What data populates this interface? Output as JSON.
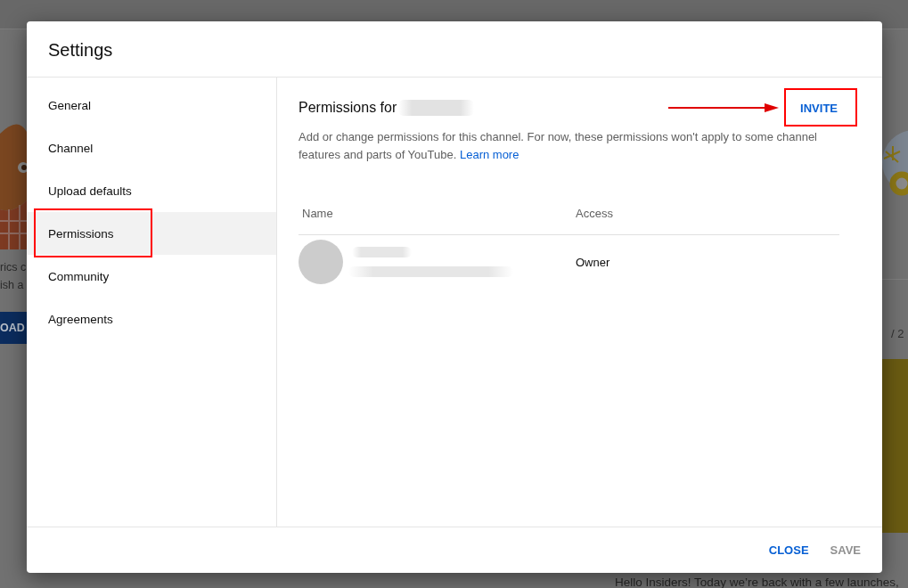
{
  "background": {
    "left_texts": [
      "rics c",
      "ish a"
    ],
    "left_button": "OAD",
    "right_counter": "/ 2",
    "bottom_text": "Hello Insiders! Today we’re back with a few launches,"
  },
  "dialog": {
    "title": "Settings",
    "sidebar": {
      "items": [
        {
          "label": "General",
          "selected": false,
          "highlighted": false
        },
        {
          "label": "Channel",
          "selected": false,
          "highlighted": false
        },
        {
          "label": "Upload defaults",
          "selected": false,
          "highlighted": false
        },
        {
          "label": "Permissions",
          "selected": true,
          "highlighted": true
        },
        {
          "label": "Community",
          "selected": false,
          "highlighted": false
        },
        {
          "label": "Agreements",
          "selected": false,
          "highlighted": false
        }
      ]
    },
    "content": {
      "heading": "Permissions for",
      "heading_redacted": true,
      "invite": {
        "label": "INVITE",
        "highlighted": true,
        "arrow": true
      },
      "description": "Add or change permissions for this channel. For now, these permissions won't apply to some channel features and parts of YouTube.",
      "link": "Learn more",
      "table": {
        "columns": [
          "Name",
          "Access"
        ],
        "rows": [
          {
            "redacted": true,
            "access": "Owner"
          }
        ]
      }
    },
    "footer": {
      "buttons": [
        {
          "label": "CLOSE",
          "disabled": false
        },
        {
          "label": "SAVE",
          "disabled": true
        }
      ]
    }
  }
}
